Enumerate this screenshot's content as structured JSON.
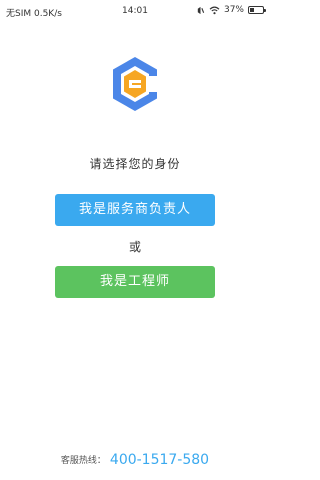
{
  "status_bar": {
    "carrier": "无SIM 0.5K/s",
    "time": "14:01",
    "battery_percent": "37%",
    "battery_level": 0.37
  },
  "main": {
    "prompt": "请选择您的身份",
    "provider_button_label": "我是服务商负责人",
    "or_label": "或",
    "engineer_button_label": "我是工程师"
  },
  "footer": {
    "hotline_label": "客服热线：",
    "hotline_number": "400-1517-580"
  },
  "colors": {
    "primary_blue": "#3aa9ef",
    "green": "#5cc35f",
    "logo_blue": "#4b86e8",
    "logo_orange": "#f6a623"
  },
  "icons": {
    "app_logo": "app-logo-icon",
    "alarm": "alarm-icon",
    "wifi": "wifi-icon",
    "battery": "battery-icon"
  }
}
